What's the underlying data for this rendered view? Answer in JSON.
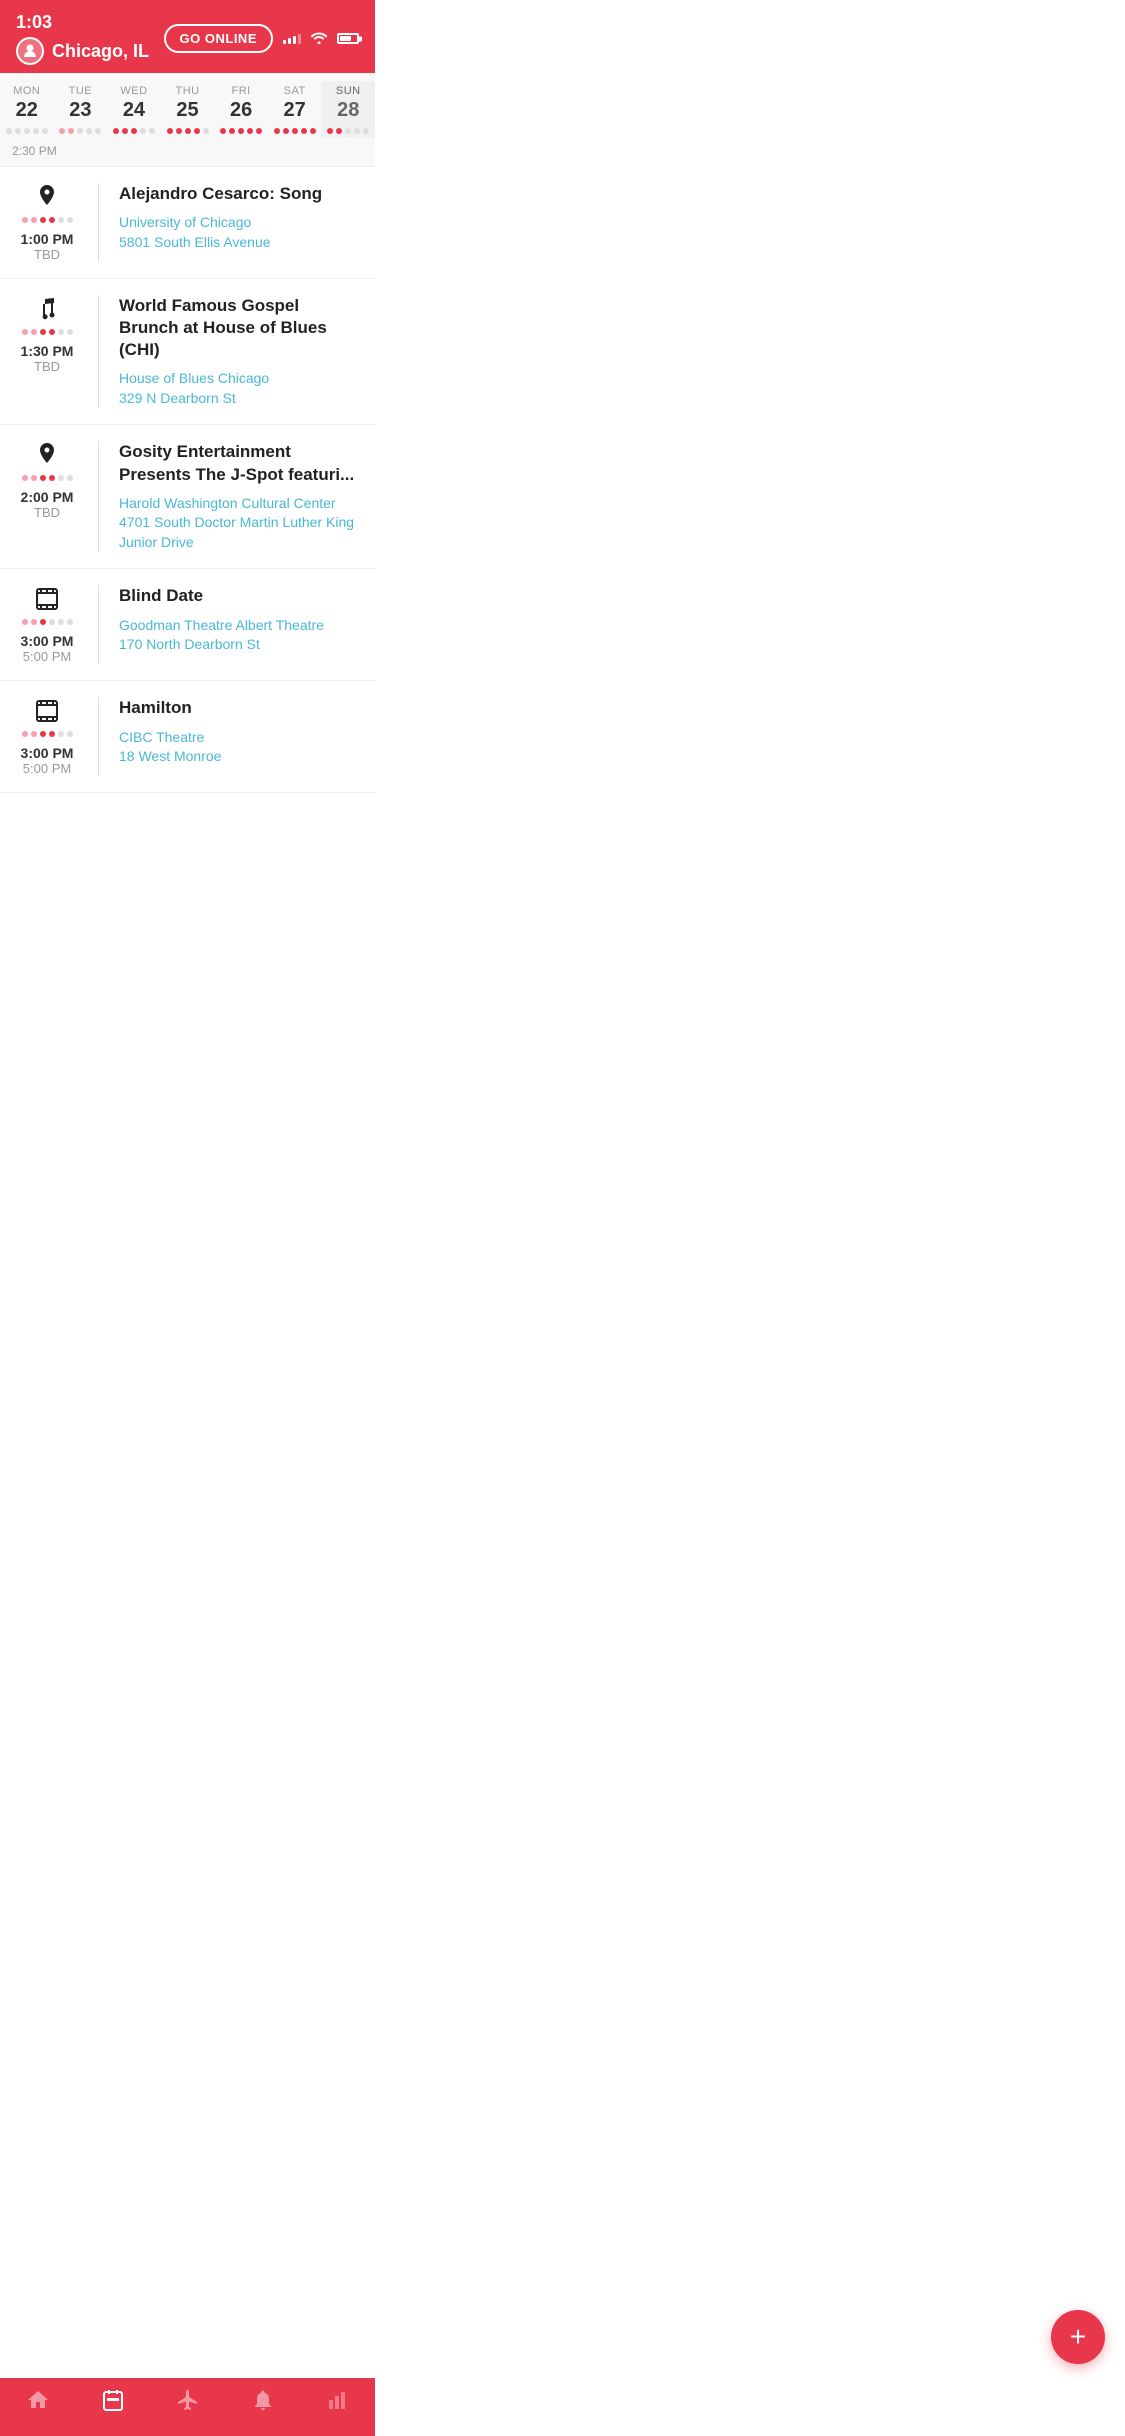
{
  "statusBar": {
    "time": "1:03",
    "location": "Chicago, IL",
    "goOnlineLabel": "GO ONLINE"
  },
  "calendar": {
    "days": [
      {
        "name": "MON",
        "num": "22",
        "dots": [
          "gray",
          "gray",
          "gray",
          "gray",
          "gray"
        ],
        "active": false
      },
      {
        "name": "TUE",
        "num": "23",
        "dots": [
          "light",
          "light",
          "gray",
          "gray",
          "gray"
        ],
        "active": false
      },
      {
        "name": "WED",
        "num": "24",
        "dots": [
          "pink",
          "pink",
          "pink",
          "gray",
          "gray"
        ],
        "active": false
      },
      {
        "name": "THU",
        "num": "25",
        "dots": [
          "pink",
          "pink",
          "pink",
          "pink",
          "gray"
        ],
        "active": false
      },
      {
        "name": "FRI",
        "num": "26",
        "dots": [
          "pink",
          "pink",
          "pink",
          "pink",
          "pink"
        ],
        "active": false
      },
      {
        "name": "SAT",
        "num": "27",
        "dots": [
          "pink",
          "pink",
          "pink",
          "pink",
          "pink"
        ],
        "active": false
      },
      {
        "name": "SUN",
        "num": "28",
        "dots": [
          "pink",
          "pink",
          "gray",
          "gray",
          "gray"
        ],
        "active": true
      }
    ],
    "timeLabel": "2:30 PM"
  },
  "events": [
    {
      "id": 1,
      "icon": "location",
      "dots": [
        "light",
        "light",
        "pink",
        "pink",
        "gray",
        "gray"
      ],
      "startTime": "1:00 PM",
      "endTime": "TBD",
      "title": "Alejandro Cesarco: Song",
      "venue": "University of Chicago",
      "address": "5801 South Ellis Avenue"
    },
    {
      "id": 2,
      "icon": "music",
      "dots": [
        "light",
        "light",
        "pink",
        "pink",
        "gray",
        "gray"
      ],
      "startTime": "1:30 PM",
      "endTime": "TBD",
      "title": "World Famous Gospel Brunch at House of Blues (CHI)",
      "venue": "House of Blues Chicago",
      "address": "329 N Dearborn St"
    },
    {
      "id": 3,
      "icon": "location",
      "dots": [
        "light",
        "light",
        "pink",
        "pink",
        "gray",
        "gray"
      ],
      "startTime": "2:00 PM",
      "endTime": "TBD",
      "title": "Gosity Entertainment Presents The J-Spot featuri...",
      "venue": "Harold Washington Cultural Center",
      "address": "4701 South Doctor Martin Luther King Junior Drive"
    },
    {
      "id": 4,
      "icon": "film",
      "dots": [
        "light",
        "light",
        "pink",
        "gray",
        "gray",
        "gray"
      ],
      "startTime": "3:00 PM",
      "endTime": "5:00 PM",
      "title": "Blind Date",
      "venue": "Goodman Theatre Albert Theatre",
      "address": "170 North Dearborn St"
    },
    {
      "id": 5,
      "icon": "film",
      "dots": [
        "light",
        "light",
        "pink",
        "pink",
        "gray",
        "gray"
      ],
      "startTime": "3:00 PM",
      "endTime": "5:00 PM",
      "title": "Hamilton",
      "venue": "CIBC Theatre",
      "address": "18 West Monroe"
    }
  ],
  "nav": {
    "items": [
      {
        "icon": "home",
        "label": "home",
        "active": false
      },
      {
        "icon": "calendar",
        "label": "calendar",
        "active": true
      },
      {
        "icon": "plane",
        "label": "explore",
        "active": false
      },
      {
        "icon": "bell",
        "label": "notifications",
        "active": false
      },
      {
        "icon": "chart",
        "label": "stats",
        "active": false
      }
    ]
  },
  "fab": {
    "label": "+"
  }
}
